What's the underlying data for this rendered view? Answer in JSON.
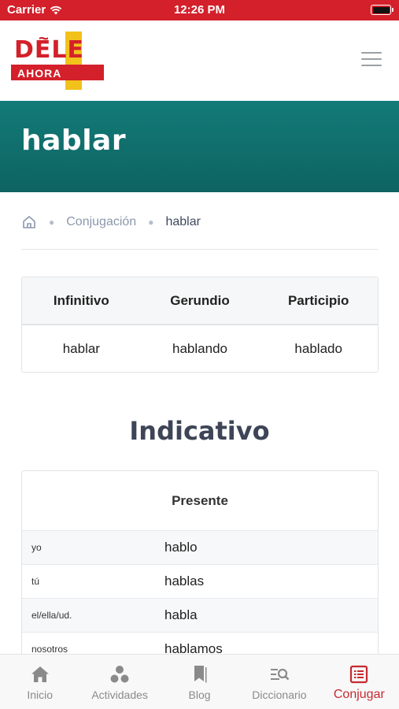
{
  "status_bar": {
    "carrier": "Carrier",
    "time": "12:26 PM"
  },
  "header": {
    "logo_text": "DELE",
    "logo_subtext": "AHORA"
  },
  "hero": {
    "title": "hablar"
  },
  "breadcrumb": {
    "section": "Conjugación",
    "current": "hablar"
  },
  "forms": {
    "headers": [
      "Infinitivo",
      "Gerundio",
      "Participio"
    ],
    "values": [
      "hablar",
      "hablando",
      "hablado"
    ]
  },
  "mood_title": "Indicativo",
  "tense": {
    "title": "Presente",
    "rows": [
      {
        "pronoun": "yo",
        "form": "hablo"
      },
      {
        "pronoun": "tú",
        "form": "hablas"
      },
      {
        "pronoun": "el/ella/ud.",
        "form": "habla"
      },
      {
        "pronoun": "nosotros",
        "form": "hablamos"
      }
    ]
  },
  "tabbar": {
    "items": [
      {
        "label": "Inicio",
        "icon": "home-icon"
      },
      {
        "label": "Actividades",
        "icon": "activities-icon"
      },
      {
        "label": "Blog",
        "icon": "bookmark-icon"
      },
      {
        "label": "Diccionario",
        "icon": "dictionary-search-icon"
      },
      {
        "label": "Conjugar",
        "icon": "list-icon"
      }
    ],
    "active_color": "#c62a31",
    "inactive_color": "#8a8a8a"
  },
  "colors": {
    "brand_red": "#d3202a",
    "brand_yellow": "#f2c21b",
    "hero_teal": "#137b78"
  }
}
